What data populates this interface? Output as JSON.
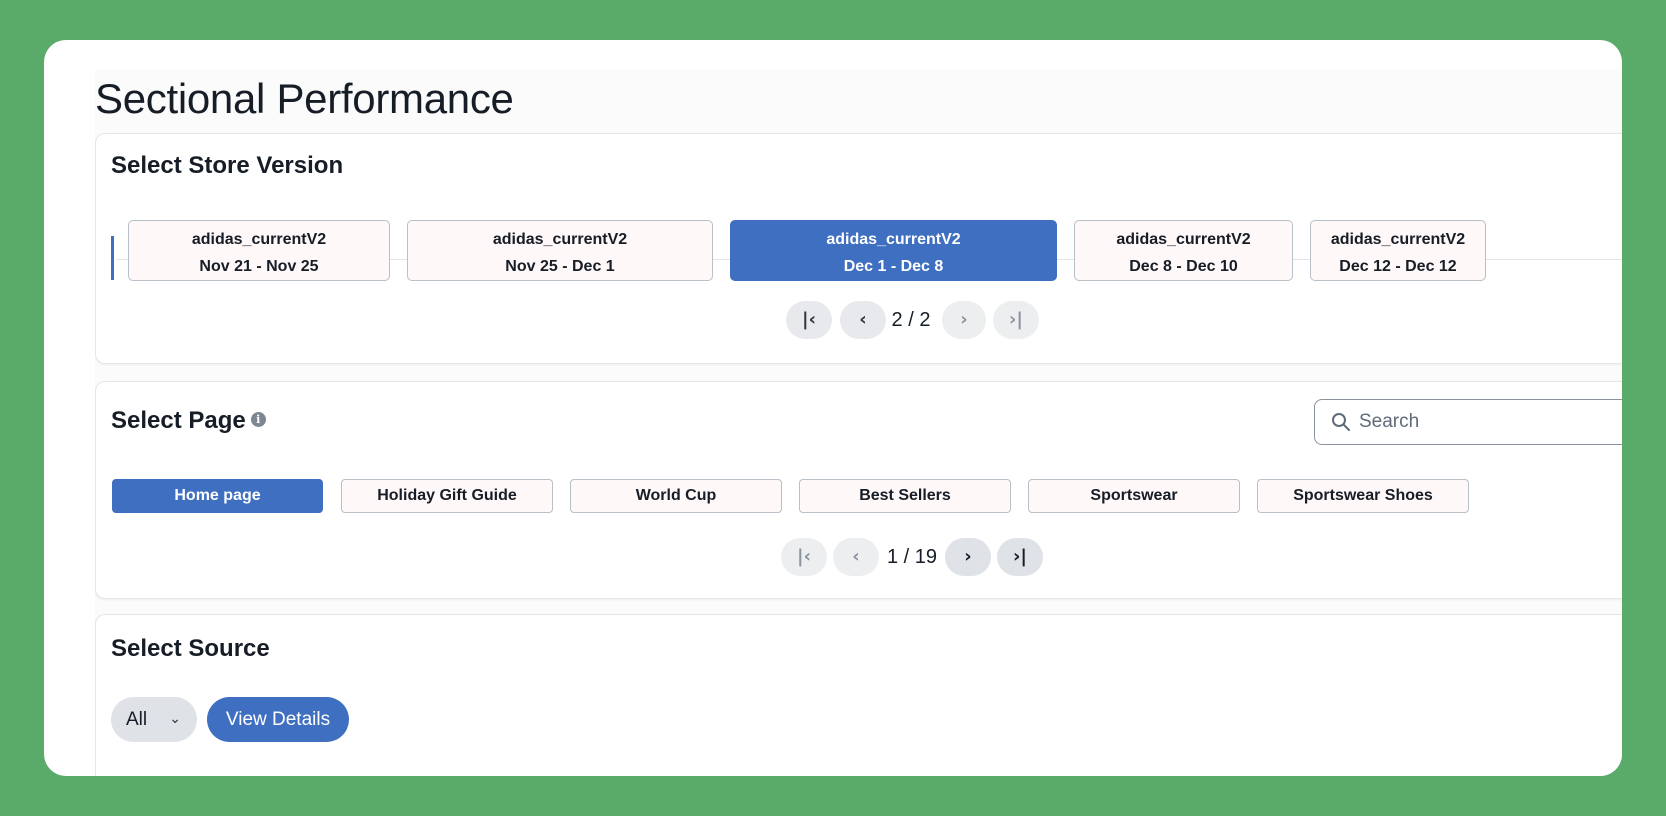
{
  "page": {
    "title": "Sectional Performance"
  },
  "store_version": {
    "title": "Select Store Version",
    "versions": [
      {
        "name": "adidas_currentV2",
        "dates": "Nov 21 - Nov 25",
        "selected": false
      },
      {
        "name": "adidas_currentV2",
        "dates": "Nov 25 - Dec 1",
        "selected": false
      },
      {
        "name": "adidas_currentV2",
        "dates": "Dec 1 - Dec 8",
        "selected": true
      },
      {
        "name": "adidas_currentV2",
        "dates": "Dec 8 - Dec 10",
        "selected": false
      },
      {
        "name": "adidas_currentV2",
        "dates": "Dec 12 - Dec 12",
        "selected": false
      }
    ],
    "pagination": {
      "label": "2 / 2"
    }
  },
  "page_select": {
    "title": "Select Page",
    "search_placeholder": "Search",
    "pages": [
      {
        "label": "Home page",
        "selected": true
      },
      {
        "label": "Holiday Gift Guide",
        "selected": false
      },
      {
        "label": "World Cup",
        "selected": false
      },
      {
        "label": "Best Sellers",
        "selected": false
      },
      {
        "label": "Sportswear",
        "selected": false
      },
      {
        "label": "Sportswear Shoes",
        "selected": false
      }
    ],
    "pagination": {
      "label": "1 / 19"
    }
  },
  "source": {
    "title": "Select Source",
    "dropdown_value": "All",
    "view_details_label": "View Details"
  },
  "colors": {
    "background": "#5aaa6a",
    "accent": "#3f6fc0",
    "chip_fill": "#fff8f8"
  },
  "icons": {
    "first": "first-page-icon",
    "prev": "chevron-left-icon",
    "next": "chevron-right-icon",
    "last": "last-page-icon",
    "search": "search-icon",
    "info": "info-icon",
    "dropdown": "chevron-down-icon"
  }
}
